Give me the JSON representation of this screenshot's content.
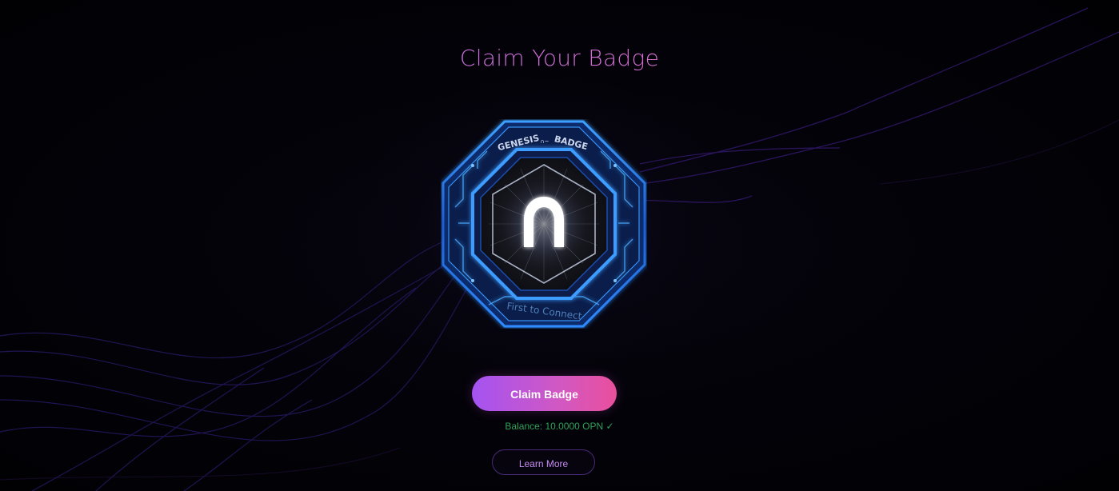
{
  "page": {
    "title": "Claim Your Badge"
  },
  "badge": {
    "top_text": "GENESIS",
    "top_text_right": "BADGE",
    "bottom_text": "First to Connect",
    "emblem_icon": "n-logo-icon"
  },
  "actions": {
    "claim_label": "Claim Badge",
    "learn_more_label": "Learn More"
  },
  "status": {
    "balance_text": "Balance: 10.0000 OPN ✓"
  },
  "colors": {
    "title_gradient_start": "#b66bf0",
    "title_gradient_end": "#e07ac8",
    "claim_gradient_start": "#a453f2",
    "claim_gradient_end": "#ea4f9c",
    "balance_color": "#2fa05a",
    "learn_more_text": "#c58af2",
    "badge_blue": "#2e8cff",
    "background": "#020106"
  }
}
